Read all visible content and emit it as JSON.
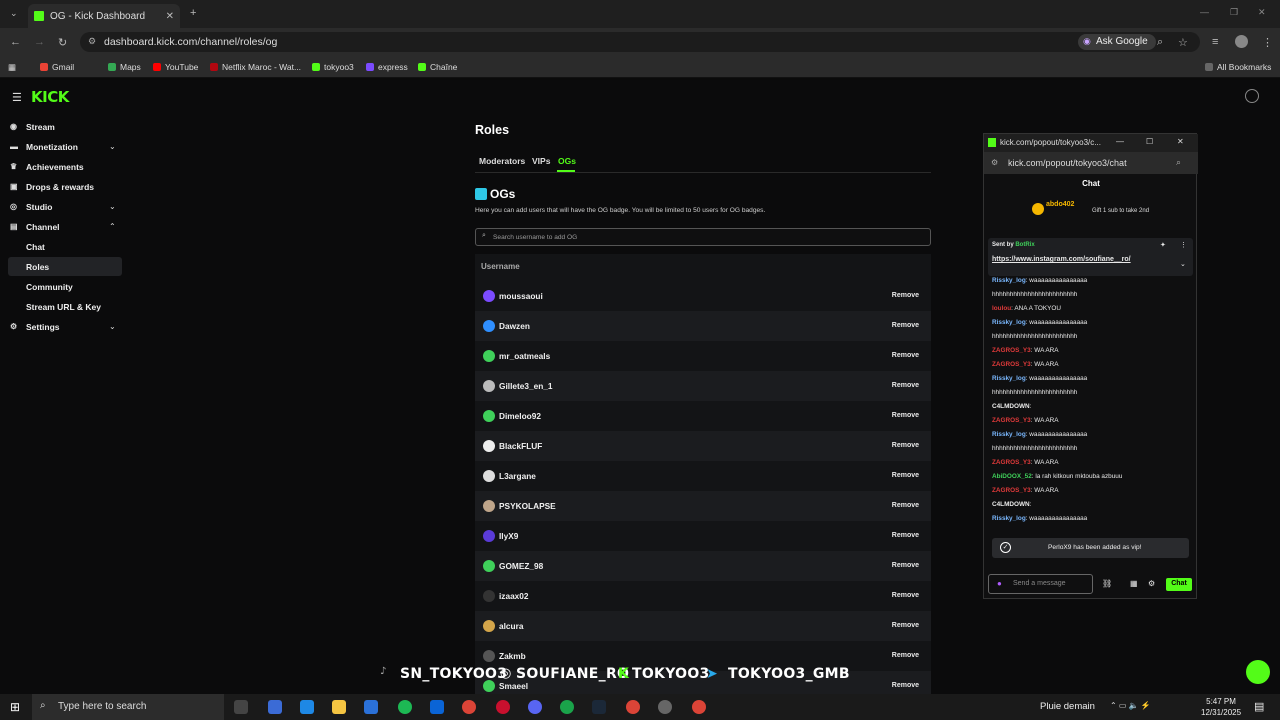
{
  "browser": {
    "tab_title": "OG - Kick Dashboard",
    "url": "dashboard.kick.com/channel/roles/og",
    "ask_google": "Ask Google",
    "bookmarks": [
      "Gmail",
      "Maps",
      "YouTube",
      "Netflix Maroc - Wat...",
      "tokyoo3",
      "express",
      "Chaîne"
    ],
    "all_bookmarks": "All Bookmarks"
  },
  "logo": "KICK",
  "sidebar": {
    "items": [
      "Stream",
      "Monetization",
      "Achievements",
      "Drops & rewards",
      "Studio",
      "Channel",
      "Chat",
      "Roles",
      "Community",
      "Stream URL & Key",
      "Settings"
    ]
  },
  "roles": {
    "title": "Roles",
    "tabs": [
      "Moderators",
      "VIPs",
      "OGs"
    ],
    "og_heading": "OGs",
    "description": "Here you can add users that will have the OG badge. You will be limited to 50 users for OG badges.",
    "search_placeholder": "Search username to add OG",
    "column": "Username",
    "remove": "Remove",
    "users": [
      {
        "name": "moussaoui",
        "color": "#7b4bff"
      },
      {
        "name": "Dawzen",
        "color": "#2f8fff"
      },
      {
        "name": "mr_oatmeals",
        "color": "#3fd05a"
      },
      {
        "name": "Gillete3_en_1",
        "color": "#bbbbbb"
      },
      {
        "name": "Dimeloo92",
        "color": "#3fd05a"
      },
      {
        "name": "BlackFLUF",
        "color": "#eeeeee"
      },
      {
        "name": "L3argane",
        "color": "#dddddd"
      },
      {
        "name": "PSYKOLAPSE",
        "color": "#bfa58a"
      },
      {
        "name": "IlyX9",
        "color": "#5a3bd8"
      },
      {
        "name": "GOMEZ_98",
        "color": "#3fd05a"
      },
      {
        "name": "izaax02",
        "color": "#333333"
      },
      {
        "name": "alcura",
        "color": "#d4a54a"
      },
      {
        "name": "Zakmb",
        "color": "#555555"
      },
      {
        "name": "Smaeel",
        "color": "#3fd05a"
      }
    ]
  },
  "overlay": {
    "items": [
      "SN_TOKYOO3",
      "SOUFIANE_RO",
      "TOKYOO3",
      "TOKYOO3_GMB"
    ]
  },
  "popout": {
    "title": "kick.com/popout/tokyoo3/c...",
    "url": "kick.com/popout/tokyoo3/chat",
    "chat_title": "Chat",
    "gift_user": "abdo402",
    "gift_text": "Gift 1 sub to take 2nd",
    "pinned_sender": "Sent by",
    "pinned_bot": "BotRix",
    "pinned_link": "https://www.instagram.com/soufiane__ro/",
    "messages": [
      {
        "user": "Rissky_log",
        "text": ": waaaaaaaaaaaaaaa",
        "cls": "blu"
      },
      {
        "user": "",
        "text": "hhhhhhhhhhhhhhhhhhhhhhhh",
        "cls": ""
      },
      {
        "user": "loulou",
        "text": ": ANA A TOKYOU",
        "cls": "red"
      },
      {
        "user": "Rissky_log",
        "text": ": waaaaaaaaaaaaaaa",
        "cls": "blu"
      },
      {
        "user": "",
        "text": "hhhhhhhhhhhhhhhhhhhhhhhh",
        "cls": ""
      },
      {
        "user": "ZAGROS_Y3",
        "text": ": WA ARA",
        "cls": "red"
      },
      {
        "user": "ZAGROS_Y3",
        "text": ": WA ARA",
        "cls": "red"
      },
      {
        "user": "Rissky_log",
        "text": ": waaaaaaaaaaaaaaa",
        "cls": "blu"
      },
      {
        "user": "",
        "text": "hhhhhhhhhhhhhhhhhhhhhhhh",
        "cls": ""
      },
      {
        "user": "C4LMDOWN",
        "text": ":",
        "cls": ""
      },
      {
        "user": "ZAGROS_Y3",
        "text": ": WA ARA",
        "cls": "red"
      },
      {
        "user": "Rissky_log",
        "text": ": waaaaaaaaaaaaaaa",
        "cls": "blu"
      },
      {
        "user": "",
        "text": "hhhhhhhhhhhhhhhhhhhhhhhh",
        "cls": ""
      },
      {
        "user": "ZAGROS_Y3",
        "text": ": WA ARA",
        "cls": "red"
      },
      {
        "user": "AbiDOOX_52",
        "text": ": la rah kitkoun mktouba azbuuu",
        "cls": "grn"
      },
      {
        "user": "ZAGROS_Y3",
        "text": ": WA ARA",
        "cls": "red"
      },
      {
        "user": "C4LMDOWN",
        "text": ":",
        "cls": ""
      },
      {
        "user": "Rissky_log",
        "text": ": waaaaaaaaaaaaaaa",
        "cls": "blu"
      }
    ],
    "toast": "PerloX9 has been added as vip!",
    "input_placeholder": "Send a message",
    "chat_button": "Chat"
  },
  "taskbar": {
    "search": "Type here to search",
    "weather": "Pluie demain",
    "time": "5:47 PM",
    "date": "12/31/2025"
  }
}
